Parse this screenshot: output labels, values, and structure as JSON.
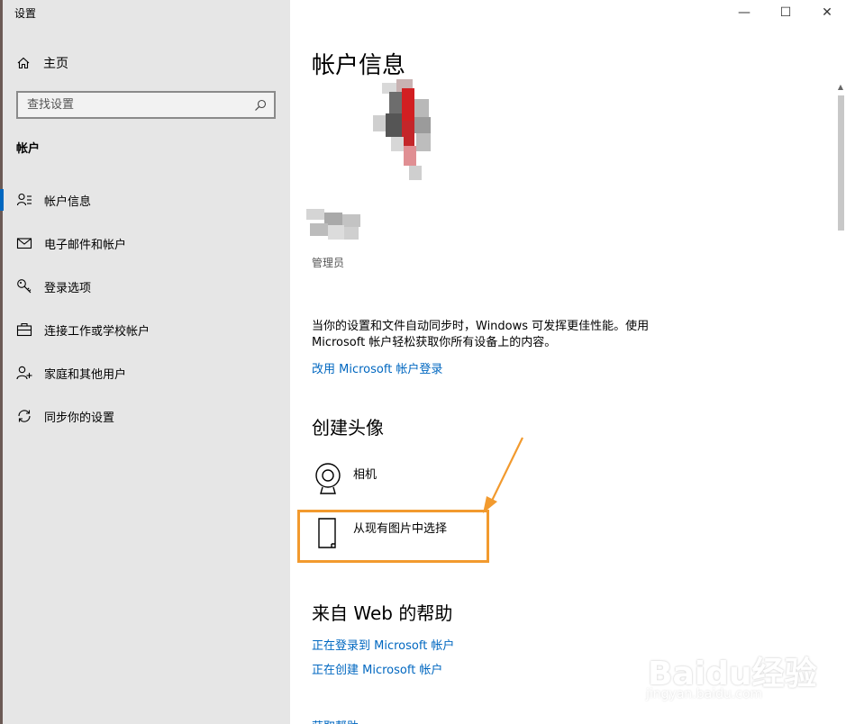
{
  "window": {
    "title": "设置",
    "minimize_glyph": "—",
    "maximize_glyph": "☐",
    "close_glyph": "✕"
  },
  "sidebar": {
    "home_label": "主页",
    "search_placeholder": "查找设置",
    "section_title": "帐户",
    "items": [
      {
        "label": "帐户信息",
        "icon": "person-card-icon",
        "active": true
      },
      {
        "label": "电子邮件和帐户",
        "icon": "mail-icon",
        "active": false
      },
      {
        "label": "登录选项",
        "icon": "key-icon",
        "active": false
      },
      {
        "label": "连接工作或学校帐户",
        "icon": "briefcase-icon",
        "active": false
      },
      {
        "label": "家庭和其他用户",
        "icon": "add-person-icon",
        "active": false
      },
      {
        "label": "同步你的设置",
        "icon": "sync-icon",
        "active": false
      }
    ]
  },
  "main": {
    "page_title": "帐户信息",
    "role": "管理员",
    "description": "当你的设置和文件自动同步时，Windows 可发挥更佳性能。使用 Microsoft 帐户轻松获取你所有设备上的内容。",
    "ms_signin_link": "改用 Microsoft 帐户登录",
    "create_avatar_title": "创建头像",
    "avatar_options": [
      {
        "label": "相机",
        "icon": "webcam-icon"
      },
      {
        "label": "从现有图片中选择",
        "icon": "file-icon"
      }
    ],
    "web_help_title": "来自 Web 的帮助",
    "web_help_links": [
      "正在登录到 Microsoft 帐户",
      "正在创建 Microsoft 帐户"
    ],
    "bottom_cut_text": "获取帮助"
  },
  "watermark": {
    "brand": "Baidu经验",
    "url": "jingyan.baidu.com"
  },
  "colors": {
    "accent": "#0067c0",
    "sidebar_bg": "#e6e6e6",
    "highlight": "#f29a2e"
  }
}
